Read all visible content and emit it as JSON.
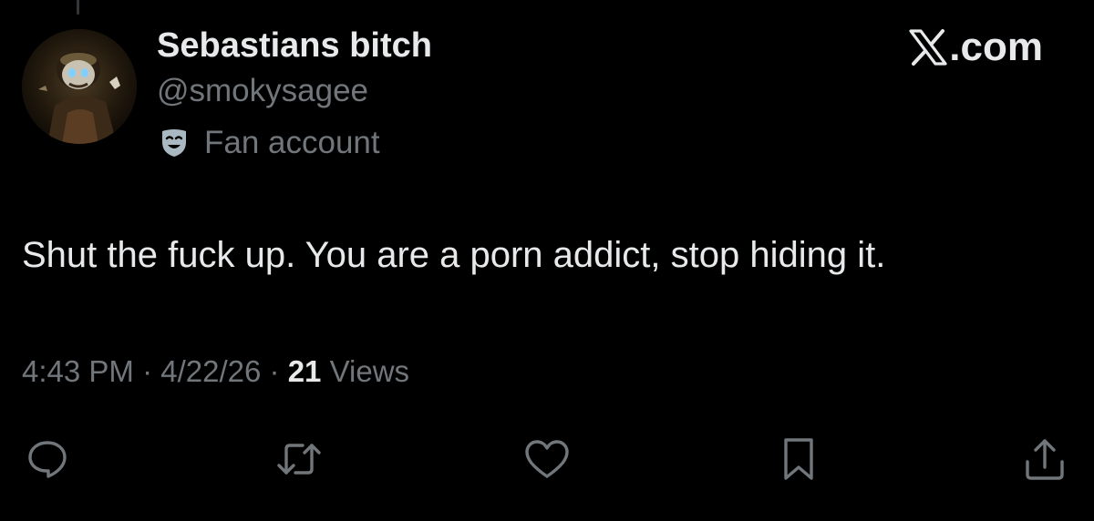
{
  "tweet": {
    "display_name": "Sebastians bitch",
    "handle": "@smokysagee",
    "affiliation": {
      "icon": "theater-masks-icon",
      "label": "Fan account"
    },
    "text": "Shut the fuck up. You are a porn addict, stop hiding it.",
    "time": "4:43 PM",
    "date": "4/22/26",
    "separator": "·",
    "views_count": "21",
    "views_label": "Views"
  },
  "brand": {
    "text": ".com",
    "icon": "x-logo-icon"
  },
  "actions": [
    {
      "name": "reply",
      "icon": "reply-icon"
    },
    {
      "name": "repost",
      "icon": "repost-icon"
    },
    {
      "name": "like",
      "icon": "heart-icon"
    },
    {
      "name": "bookmark",
      "icon": "bookmark-icon"
    },
    {
      "name": "share",
      "icon": "share-icon"
    }
  ],
  "colors": {
    "background": "#000000",
    "primary_text": "#e7e9ea",
    "secondary_text": "#71767b",
    "badge": "#aab8c2"
  }
}
